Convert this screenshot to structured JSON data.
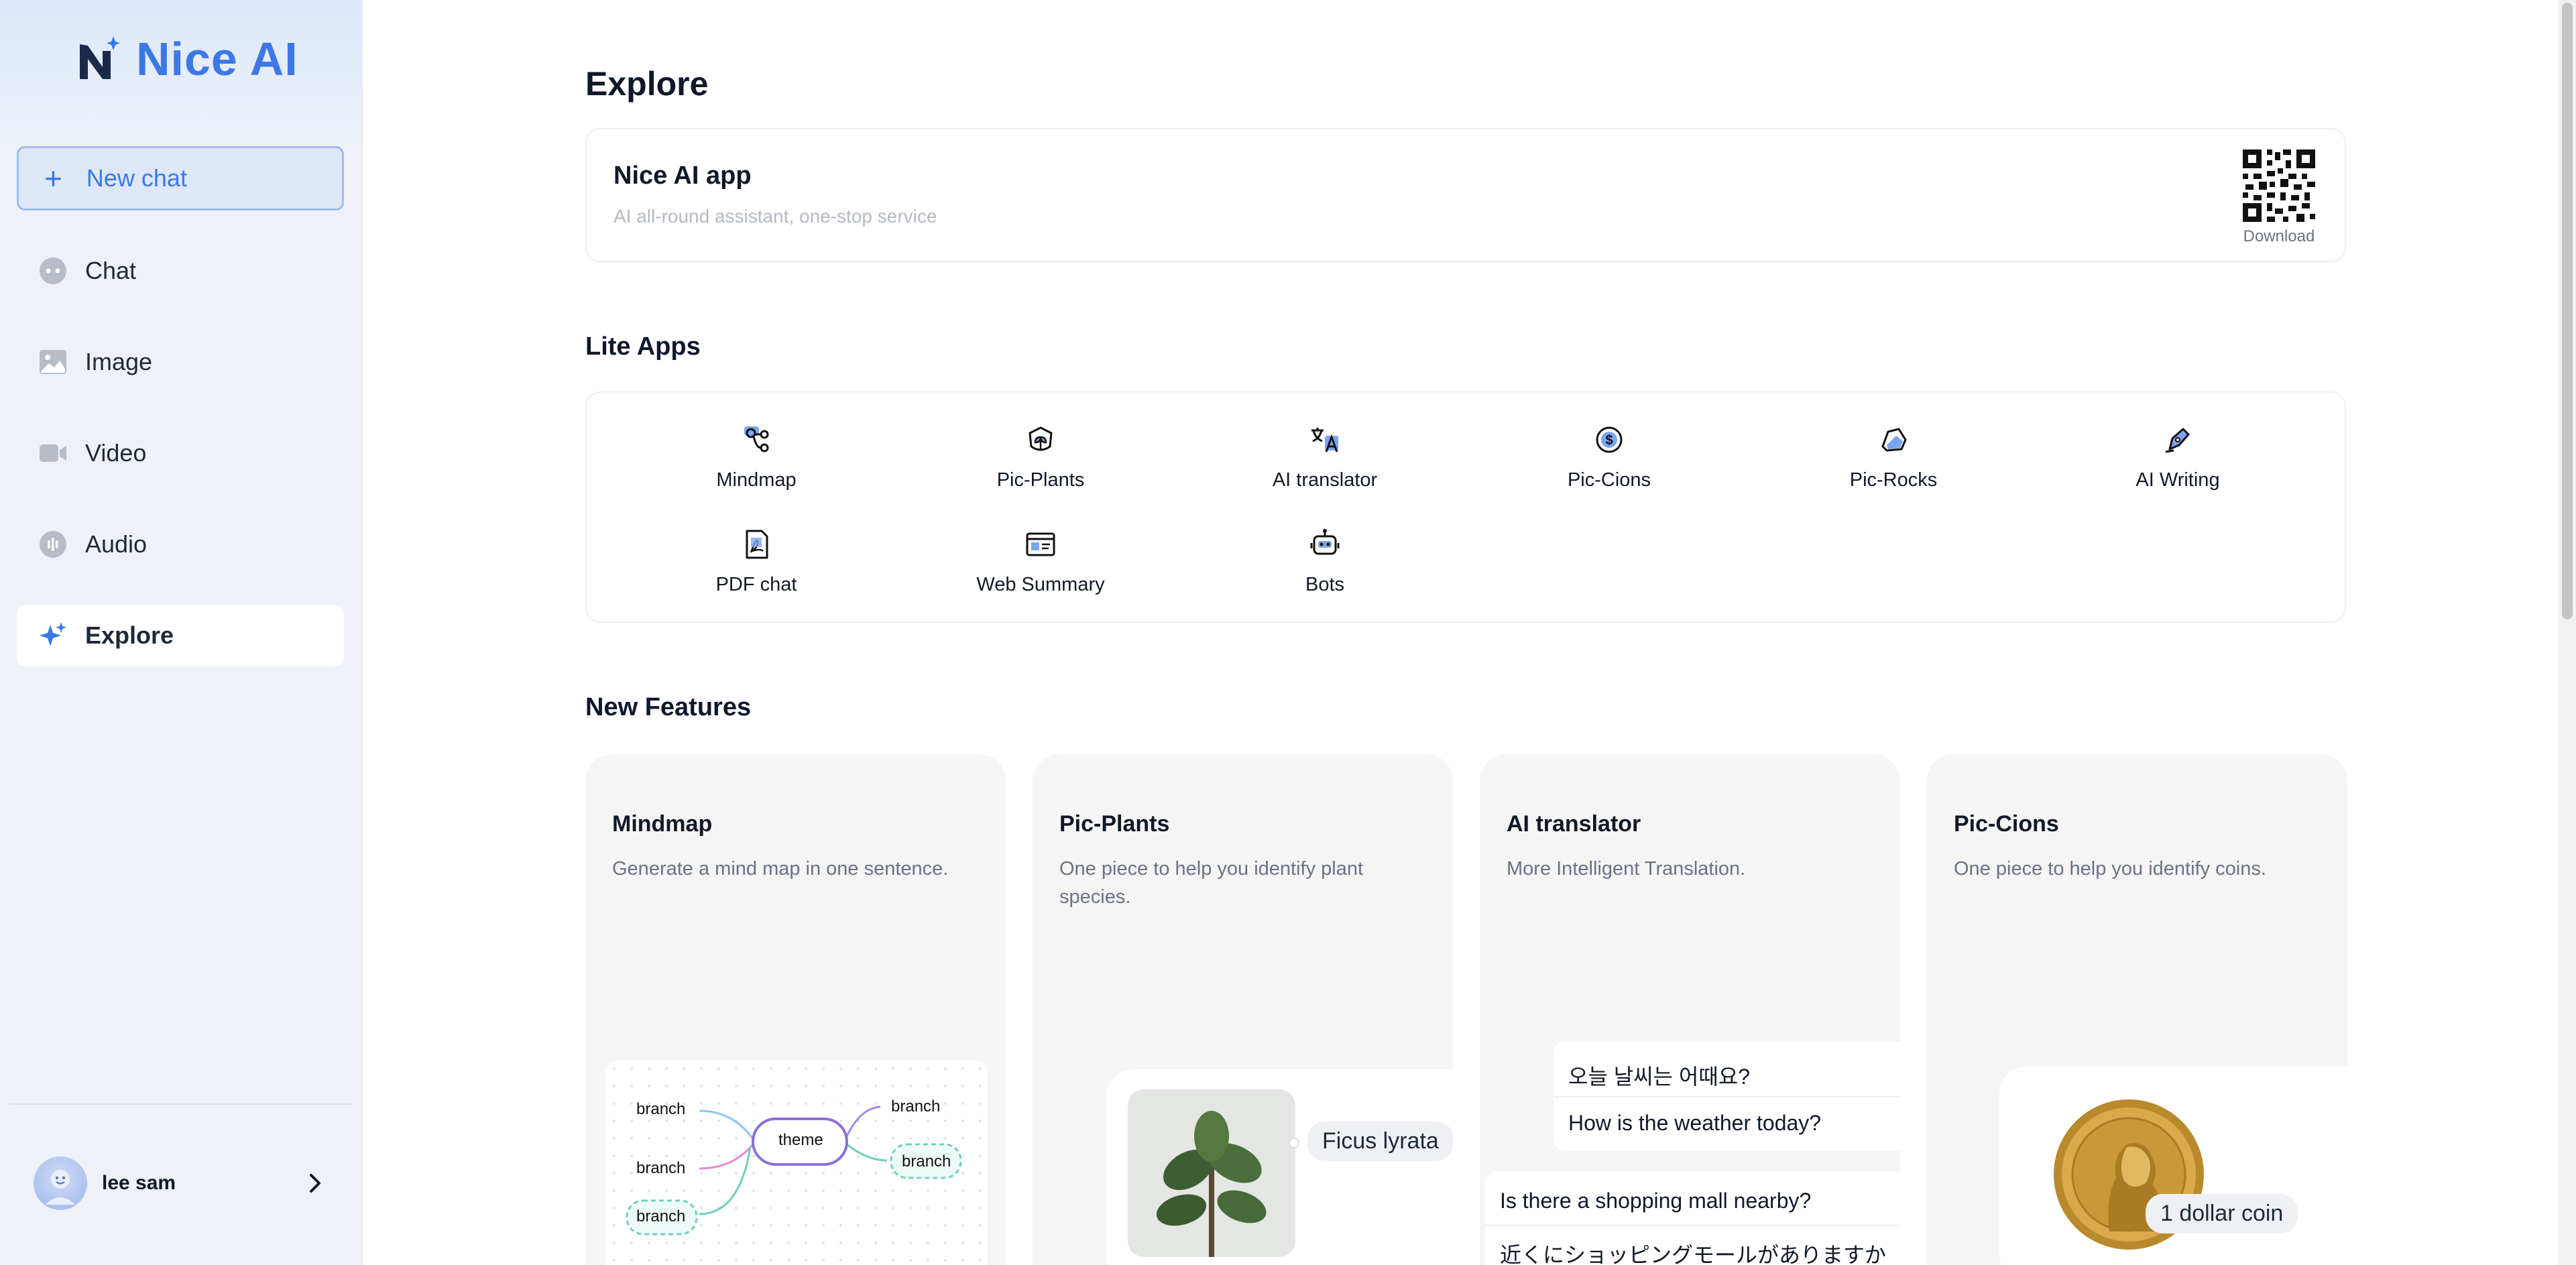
{
  "sidebar": {
    "brand": "Nice AI",
    "new_chat": "New chat",
    "items": [
      {
        "label": "Chat",
        "icon": "chat-icon"
      },
      {
        "label": "Image",
        "icon": "image-icon"
      },
      {
        "label": "Video",
        "icon": "video-icon"
      },
      {
        "label": "Audio",
        "icon": "audio-icon"
      },
      {
        "label": "Explore",
        "icon": "sparkle-icon",
        "active": true
      }
    ],
    "user": {
      "name": "lee sam"
    }
  },
  "main": {
    "title": "Explore",
    "app_card": {
      "title": "Nice AI app",
      "subtitle": "AI all-round assistant, one-stop service",
      "download": "Download"
    },
    "lite_apps": {
      "title": "Lite Apps",
      "items": [
        {
          "label": "Mindmap",
          "icon": "mindmap-icon"
        },
        {
          "label": "Pic-Plants",
          "icon": "plant-icon"
        },
        {
          "label": "AI translator",
          "icon": "translate-icon"
        },
        {
          "label": "Pic-Cions",
          "icon": "coin-icon"
        },
        {
          "label": "Pic-Rocks",
          "icon": "rock-icon"
        },
        {
          "label": "AI Writing",
          "icon": "pen-icon"
        },
        {
          "label": "PDF chat",
          "icon": "pdf-icon"
        },
        {
          "label": "Web Summary",
          "icon": "web-icon"
        },
        {
          "label": "Bots",
          "icon": "bot-icon"
        }
      ]
    },
    "new_features": {
      "title": "New Features",
      "cards": [
        {
          "title": "Mindmap",
          "desc": "Generate a mind map in one sentence.",
          "demo": {
            "center": "theme",
            "branches": [
              "branch",
              "branch",
              "branch",
              "branch",
              "branch"
            ]
          }
        },
        {
          "title": "Pic-Plants",
          "desc": "One piece to help you identify plant species.",
          "demo": {
            "label": "Ficus lyrata"
          }
        },
        {
          "title": "AI translator",
          "desc": "More Intelligent Translation.",
          "demo": {
            "lines": [
              "오늘 날씨는 어때요?",
              "How is the weather today?",
              "Is there a shopping mall nearby?",
              "近くにショッピングモールがありますか"
            ]
          }
        },
        {
          "title": "Pic-Cions",
          "desc": "One piece to help you identify coins.",
          "demo": {
            "label": "1 dollar coin"
          }
        }
      ]
    }
  },
  "colors": {
    "accent": "#3c78e6",
    "sidebar_bg": "#eef2f8",
    "card_bg": "#f5f5f6"
  }
}
